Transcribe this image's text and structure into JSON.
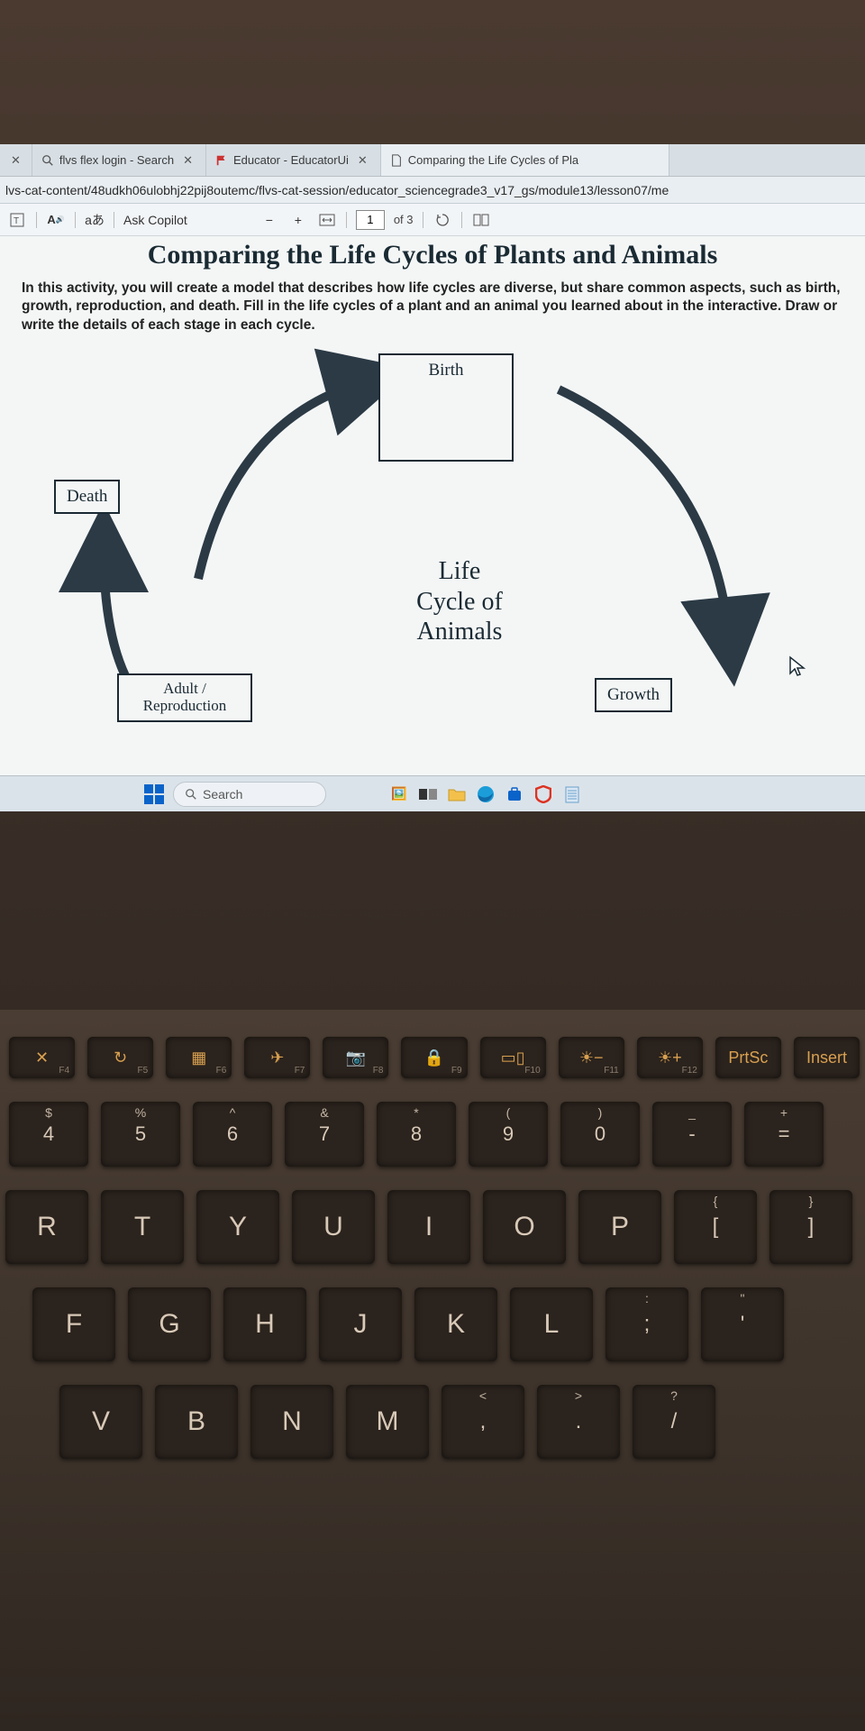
{
  "tabs": [
    {
      "label": "flvs flex login - Search",
      "favicon": "magnifier"
    },
    {
      "label": "Educator - EducatorUi",
      "favicon": "flag"
    },
    {
      "label": "Comparing the Life Cycles of Pla",
      "favicon": "document"
    }
  ],
  "address_bar": "lvs-cat-content/48udkh06ulobhj22pij8outemc/flvs-cat-session/educator_sciencegrade3_v17_gs/module13/lesson07/me",
  "pdf_toolbar": {
    "copilot_label": "Ask Copilot",
    "page_current": "1",
    "page_total": "of 3"
  },
  "document": {
    "title": "Comparing the Life Cycles of Plants and Animals",
    "intro": "In this activity, you will create a model that describes how life cycles are diverse, but share common aspects, such as birth, growth, reproduction, and death. Fill in the life cycles of a plant and an animal you learned about in the interactive. Draw or write the details of each stage in each cycle.",
    "center_label_1": "Life",
    "center_label_2": "Cycle of",
    "center_label_3": "Animals",
    "stages": {
      "birth": "Birth",
      "growth": "Growth",
      "adult": "Adult / Reproduction",
      "death": "Death"
    }
  },
  "taskbar": {
    "search_placeholder": "Search"
  },
  "keyboard": {
    "fn_row": [
      {
        "glyph": "✕",
        "sub": "F4"
      },
      {
        "glyph": "↻",
        "sub": "F5"
      },
      {
        "glyph": "▦",
        "sub": "F6"
      },
      {
        "glyph": "✈",
        "sub": "F7"
      },
      {
        "glyph": "📷",
        "sub": "F8"
      },
      {
        "glyph": "🔒",
        "sub": "F9"
      },
      {
        "glyph": "▭▯",
        "sub": "F10"
      },
      {
        "glyph": "☀−",
        "sub": "F11"
      },
      {
        "glyph": "☀+",
        "sub": "F12"
      },
      {
        "glyph": "PrtSc",
        "sub": ""
      },
      {
        "glyph": "Insert",
        "sub": ""
      }
    ],
    "num_row": [
      {
        "top": "$",
        "main": "4"
      },
      {
        "top": "%",
        "main": "5"
      },
      {
        "top": "^",
        "main": "6"
      },
      {
        "top": "&",
        "main": "7"
      },
      {
        "top": "*",
        "main": "8"
      },
      {
        "top": "(",
        "main": "9"
      },
      {
        "top": ")",
        "main": "0"
      },
      {
        "top": "_",
        "main": "-"
      },
      {
        "top": "+",
        "main": "="
      }
    ],
    "row_q": [
      {
        "main": "R"
      },
      {
        "main": "T"
      },
      {
        "main": "Y"
      },
      {
        "main": "U"
      },
      {
        "main": "I"
      },
      {
        "main": "O"
      },
      {
        "main": "P"
      },
      {
        "top": "{",
        "main": "["
      },
      {
        "top": "}",
        "main": "]"
      }
    ],
    "row_a": [
      {
        "main": "F"
      },
      {
        "main": "G"
      },
      {
        "main": "H"
      },
      {
        "main": "J"
      },
      {
        "main": "K"
      },
      {
        "main": "L"
      },
      {
        "top": ":",
        "main": ";"
      },
      {
        "top": "\"",
        "main": "'"
      }
    ],
    "row_z": [
      {
        "main": "V"
      },
      {
        "main": "B"
      },
      {
        "main": "N"
      },
      {
        "main": "M"
      },
      {
        "top": "<",
        "main": ","
      },
      {
        "top": ">",
        "main": "."
      },
      {
        "top": "?",
        "main": "/"
      }
    ]
  }
}
